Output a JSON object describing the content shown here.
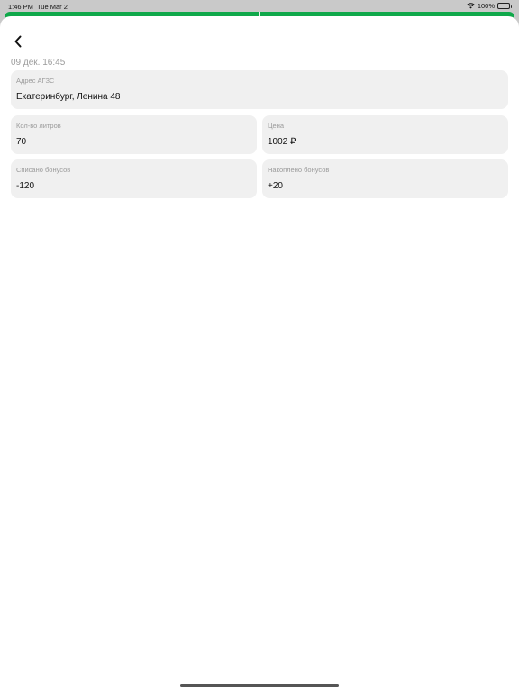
{
  "status_bar": {
    "time": "1:46 PM",
    "date": "Tue Mar 2",
    "battery": "100%"
  },
  "colors": {
    "accent_green": "#0fa84a",
    "card_bg": "#f0f0f0"
  },
  "header": {
    "back_icon": "chevron-left-icon"
  },
  "transaction": {
    "datetime": "09 дек. 16:45",
    "address": {
      "label": "Адрес АГЗС",
      "value": "Екатеринбург, Ленина 48"
    },
    "liters": {
      "label": "Кол-во литров",
      "value": "70"
    },
    "price": {
      "label": "Цена",
      "value": "1002 ₽"
    },
    "bonus_spent": {
      "label": "Списано бонусов",
      "value": "-120"
    },
    "bonus_earned": {
      "label": "Накоплено бонусов",
      "value": "+20"
    }
  }
}
